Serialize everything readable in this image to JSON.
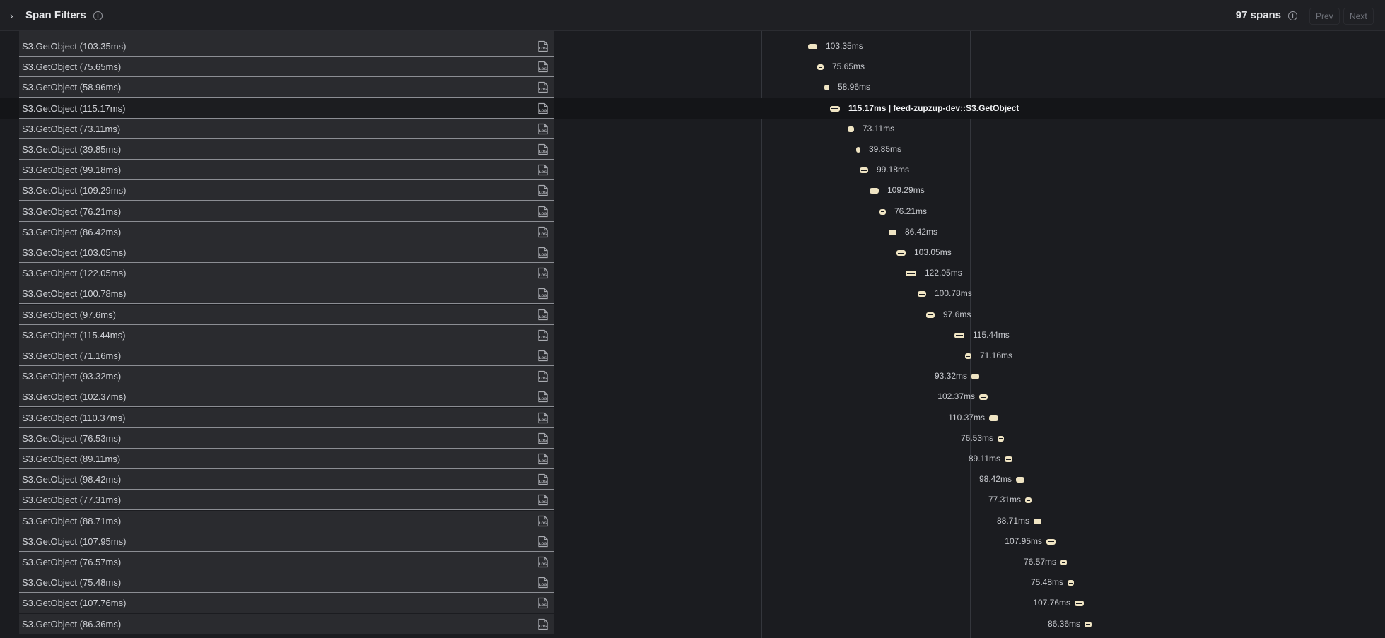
{
  "header": {
    "title": "Span Filters",
    "spans_count": "97 spans",
    "prev_label": "Prev",
    "next_label": "Next"
  },
  "highlighted_label": "115.17ms | feed-zupzup-dev::S3.GetObject",
  "rows": [
    {
      "name": "S3.GetObject (103.35ms)",
      "duration": "103.35ms",
      "bar_start": 1143,
      "side": "right"
    },
    {
      "name": "S3.GetObject (75.65ms)",
      "duration": "75.65ms",
      "bar_start": 1156,
      "side": "right"
    },
    {
      "name": "S3.GetObject (58.96ms)",
      "duration": "58.96ms",
      "bar_start": 1166,
      "side": "right"
    },
    {
      "name": "S3.GetObject (115.17ms)",
      "duration": "115.17ms",
      "bar_start": 1174,
      "side": "right",
      "highlight": true
    },
    {
      "name": "S3.GetObject (73.11ms)",
      "duration": "73.11ms",
      "bar_start": 1199,
      "side": "right"
    },
    {
      "name": "S3.GetObject (39.85ms)",
      "duration": "39.85ms",
      "bar_start": 1211,
      "side": "right"
    },
    {
      "name": "S3.GetObject (99.18ms)",
      "duration": "99.18ms",
      "bar_start": 1216,
      "side": "right"
    },
    {
      "name": "S3.GetObject (109.29ms)",
      "duration": "109.29ms",
      "bar_start": 1230,
      "side": "right"
    },
    {
      "name": "S3.GetObject (76.21ms)",
      "duration": "76.21ms",
      "bar_start": 1244,
      "side": "right"
    },
    {
      "name": "S3.GetObject (86.42ms)",
      "duration": "86.42ms",
      "bar_start": 1257,
      "side": "right"
    },
    {
      "name": "S3.GetObject (103.05ms)",
      "duration": "103.05ms",
      "bar_start": 1268,
      "side": "right"
    },
    {
      "name": "S3.GetObject (122.05ms)",
      "duration": "122.05ms",
      "bar_start": 1281,
      "side": "right"
    },
    {
      "name": "S3.GetObject (100.78ms)",
      "duration": "100.78ms",
      "bar_start": 1298,
      "side": "right"
    },
    {
      "name": "S3.GetObject (97.6ms)",
      "duration": "97.6ms",
      "bar_start": 1310,
      "side": "right"
    },
    {
      "name": "S3.GetObject (115.44ms)",
      "duration": "115.44ms",
      "bar_start": 1350,
      "side": "right"
    },
    {
      "name": "S3.GetObject (71.16ms)",
      "duration": "71.16ms",
      "bar_start": 1365,
      "side": "right"
    },
    {
      "name": "S3.GetObject (93.32ms)",
      "duration": "93.32ms",
      "bar_start": 1374,
      "side": "left"
    },
    {
      "name": "S3.GetObject (102.37ms)",
      "duration": "102.37ms",
      "bar_start": 1385,
      "side": "left"
    },
    {
      "name": "S3.GetObject (110.37ms)",
      "duration": "110.37ms",
      "bar_start": 1399,
      "side": "left"
    },
    {
      "name": "S3.GetObject (76.53ms)",
      "duration": "76.53ms",
      "bar_start": 1411,
      "side": "left"
    },
    {
      "name": "S3.GetObject (89.11ms)",
      "duration": "89.11ms",
      "bar_start": 1421,
      "side": "left"
    },
    {
      "name": "S3.GetObject (98.42ms)",
      "duration": "98.42ms",
      "bar_start": 1437,
      "side": "left"
    },
    {
      "name": "S3.GetObject (77.31ms)",
      "duration": "77.31ms",
      "bar_start": 1450,
      "side": "left"
    },
    {
      "name": "S3.GetObject (88.71ms)",
      "duration": "88.71ms",
      "bar_start": 1462,
      "side": "left"
    },
    {
      "name": "S3.GetObject (107.95ms)",
      "duration": "107.95ms",
      "bar_start": 1480,
      "side": "left"
    },
    {
      "name": "S3.GetObject (76.57ms)",
      "duration": "76.57ms",
      "bar_start": 1500,
      "side": "left"
    },
    {
      "name": "S3.GetObject (75.48ms)",
      "duration": "75.48ms",
      "bar_start": 1510,
      "side": "left"
    },
    {
      "name": "S3.GetObject (107.76ms)",
      "duration": "107.76ms",
      "bar_start": 1520,
      "side": "left"
    },
    {
      "name": "S3.GetObject (86.36ms)",
      "duration": "86.36ms",
      "bar_start": 1534,
      "side": "left"
    }
  ]
}
